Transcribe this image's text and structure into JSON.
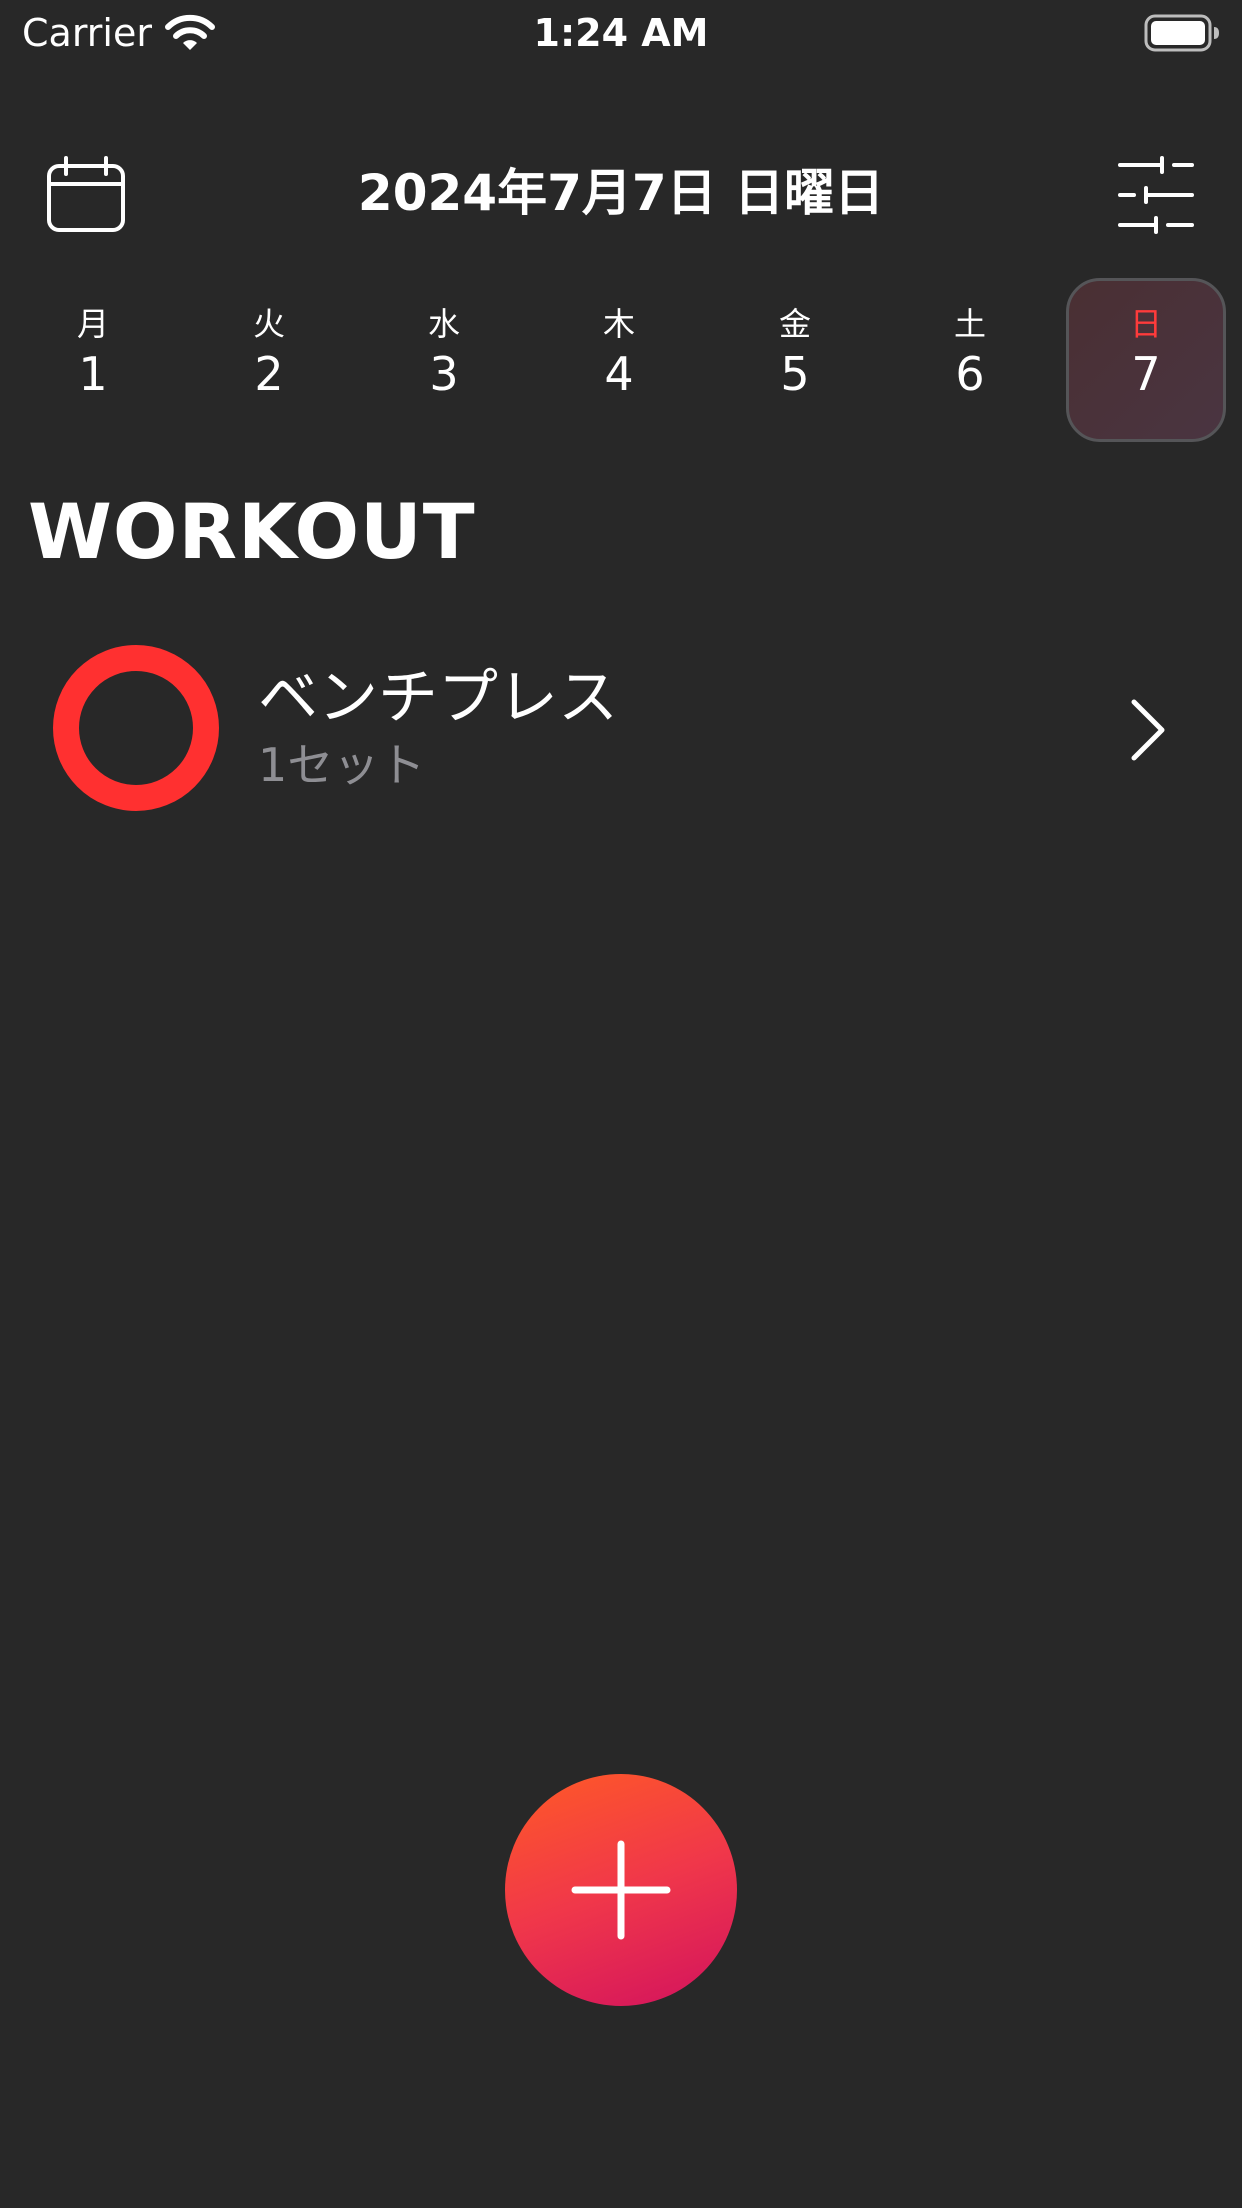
{
  "status_bar": {
    "carrier": "Carrier",
    "time": "1:24 AM",
    "wifi_icon": "wifi-icon",
    "battery_icon": "battery-icon"
  },
  "header": {
    "title": "2024年7月7日 日曜日",
    "calendar_icon": "calendar-icon",
    "filter_icon": "sliders-icon"
  },
  "week": {
    "days": [
      {
        "dow": "月",
        "num": "1",
        "selected": false
      },
      {
        "dow": "火",
        "num": "2",
        "selected": false
      },
      {
        "dow": "水",
        "num": "3",
        "selected": false
      },
      {
        "dow": "木",
        "num": "4",
        "selected": false
      },
      {
        "dow": "金",
        "num": "5",
        "selected": false
      },
      {
        "dow": "土",
        "num": "6",
        "selected": false
      },
      {
        "dow": "日",
        "num": "7",
        "selected": true
      }
    ]
  },
  "section": {
    "title": "WORKOUT"
  },
  "workouts": [
    {
      "name": "ベンチプレス",
      "sets": "1セット",
      "icon": "progress-ring-icon"
    }
  ],
  "fab": {
    "icon": "plus-icon"
  },
  "colors": {
    "background": "#282828",
    "accent_red": "#ff3030",
    "selected_day_text": "#ff3b3b",
    "secondary_text": "#8e8e93",
    "fab_gradient_start": "#ff5a26",
    "fab_gradient_end": "#d2125e"
  }
}
